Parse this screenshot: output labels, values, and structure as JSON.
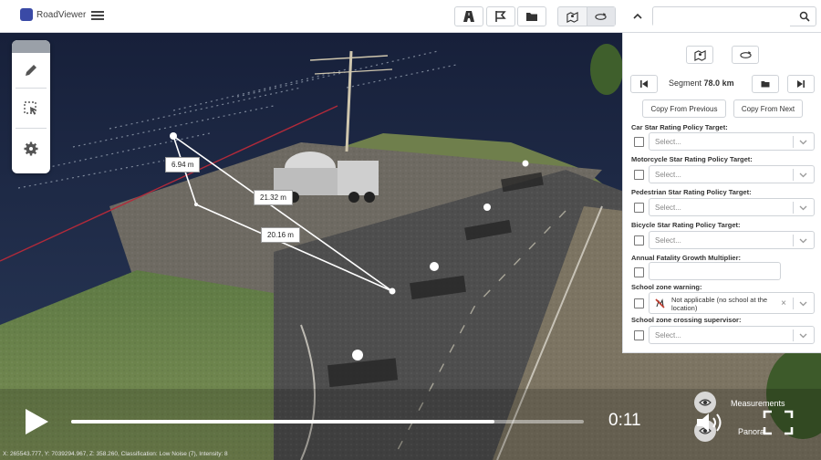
{
  "app": {
    "name": "RoadViewer",
    "accent": "#3a4aa6"
  },
  "search": {
    "value": "",
    "placeholder": ""
  },
  "measurements": [
    {
      "label": "6.94 m"
    },
    {
      "label": "21.32 m"
    },
    {
      "label": "20.16 m"
    }
  ],
  "panel": {
    "segment_prefix": "Segment",
    "segment_value": "78.0 km",
    "copy_previous": "Copy From Previous",
    "copy_next": "Copy From Next",
    "fields": [
      {
        "label": "Car Star Rating Policy Target:",
        "placeholder": "Select..."
      },
      {
        "label": "Motorcycle Star Rating Policy Target:",
        "placeholder": "Select..."
      },
      {
        "label": "Pedestrian Star Rating Policy Target:",
        "placeholder": "Select..."
      },
      {
        "label": "Bicycle Star Rating Policy Target:",
        "placeholder": "Select..."
      }
    ],
    "growth_label": "Annual Fatality Growth Multiplier:",
    "growth_value": "",
    "school_warning_label": "School zone warning:",
    "school_warning_value": "Not applicable (no school at the location)",
    "school_supervisor_label": "School zone crossing supervisor:",
    "school_supervisor_placeholder": "Select..."
  },
  "status": {
    "text": "X: 265543.777, Y: 7039294.967, Z: 358.260, Classification: Low Noise (7), Intensity: 8"
  },
  "layers": {
    "measurements": "Measurements",
    "panorama": "Panora"
  },
  "video": {
    "time": "0:11",
    "progress": 0.825
  }
}
